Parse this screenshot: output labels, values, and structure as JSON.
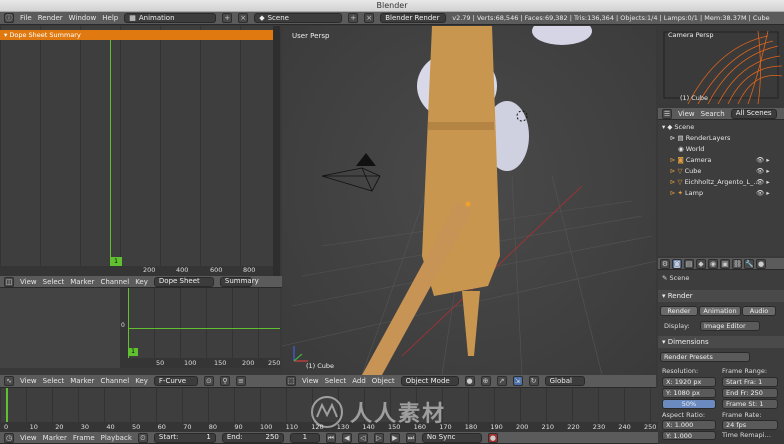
{
  "window_title": "Blender",
  "info_header": {
    "menus": [
      "File",
      "Render",
      "Window",
      "Help"
    ],
    "layout": "Animation",
    "scene": "Scene",
    "engine": "Blender Render",
    "stats": "v2.79 | Verts:68,546 | Faces:69,382 | Tris:136,364 | Objects:1/4 | Lamps:0/1 | Mem:38.37M | Cube"
  },
  "dopesheet_top": {
    "summary_label": "Dope Sheet Summary",
    "frame_marker": "1",
    "ticks": [
      "200",
      "400",
      "600",
      "800"
    ],
    "header_menus": [
      "View",
      "Select",
      "Marker",
      "Channel",
      "Key"
    ],
    "mode": "Dope Sheet",
    "summary_btn": "Summary"
  },
  "graph_editor": {
    "y_marker": "0",
    "frame_marker": "1",
    "ticks": [
      "50",
      "100",
      "150",
      "200",
      "250"
    ],
    "header_menus": [
      "View",
      "Select",
      "Marker",
      "Channel",
      "Key"
    ],
    "mode": "F-Curve"
  },
  "viewport": {
    "label": "User Persp",
    "object_label": "(1) Cube",
    "header_menus": [
      "View",
      "Select",
      "Add",
      "Object"
    ],
    "mode": "Object Mode",
    "orientation": "Global"
  },
  "camera_view": {
    "label": "Camera Persp",
    "object_label": "(1) Cube"
  },
  "outliner": {
    "tabs": [
      "View",
      "Search",
      "All Scenes"
    ],
    "items": [
      {
        "name": "Scene"
      },
      {
        "name": "RenderLayers"
      },
      {
        "name": "World"
      },
      {
        "name": "Camera"
      },
      {
        "name": "Cube"
      },
      {
        "name": "Eichholtz_Argento_L_…"
      },
      {
        "name": "Lamp"
      }
    ]
  },
  "properties": {
    "scene_label": "Scene",
    "render_section": "Render",
    "render_buttons": [
      "Render",
      "Animation",
      "Audio"
    ],
    "display_label": "Display:",
    "display_value": "Image Editor",
    "dimensions_section": "Dimensions",
    "render_presets": "Render Presets",
    "resolution_label": "Resolution:",
    "res_x": "X: 1920 px",
    "res_y": "Y: 1080 px",
    "res_pct": "50%",
    "frame_range_label": "Frame Range:",
    "start_frame": "Start Fra: 1",
    "end_frame": "End Fr: 250",
    "frame_step": "Frame St: 1",
    "aspect_label": "Aspect Ratio:",
    "aspect_x": "X: 1.000",
    "aspect_y": "Y: 1.000",
    "frame_rate_label": "Frame Rate:",
    "frame_rate": "24 fps",
    "time_remap": "Time Remapi…"
  },
  "timeline": {
    "ticks": [
      "0",
      "10",
      "20",
      "30",
      "40",
      "50",
      "60",
      "70",
      "80",
      "90",
      "100",
      "110",
      "120",
      "130",
      "140",
      "150",
      "160",
      "170",
      "180",
      "190",
      "200",
      "210",
      "220",
      "230",
      "240",
      "250"
    ],
    "header_menus": [
      "View",
      "Marker",
      "Frame",
      "Playback"
    ],
    "start": "Start:",
    "start_val": "1",
    "end": "End:",
    "end_val": "250",
    "current": "1",
    "sync": "No Sync"
  },
  "watermark": "人人素材",
  "colors": {
    "accent_orange": "#e07a10",
    "green_cursor": "#60c030",
    "object_tan": "#c8964f",
    "panel_dark": "#393939"
  }
}
